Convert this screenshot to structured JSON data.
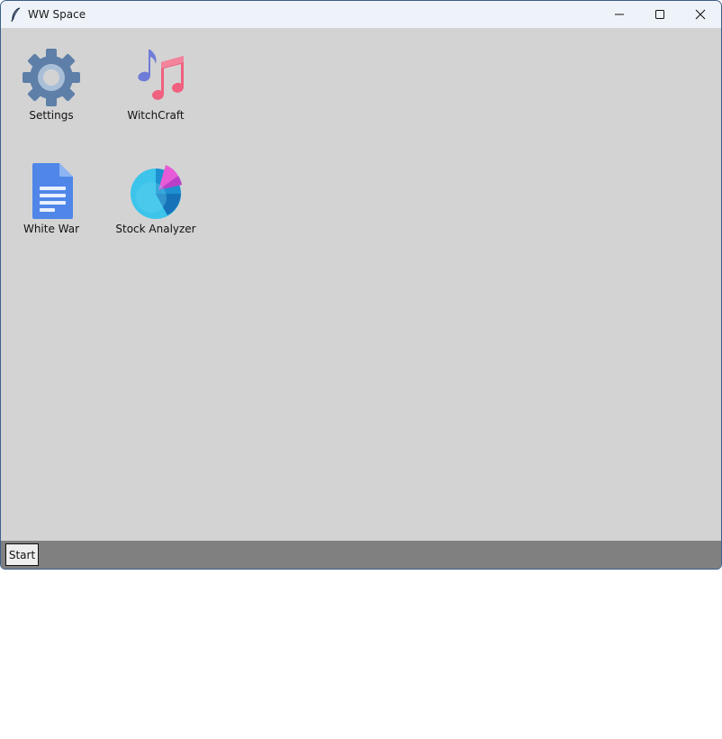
{
  "window": {
    "title": "WW Space",
    "title_icon": "feather-icon",
    "controls": {
      "minimize_icon": "minimize-icon",
      "maximize_icon": "maximize-icon",
      "close_icon": "close-icon"
    }
  },
  "desktop": {
    "background_color": "#d3d3d3",
    "icons": [
      {
        "label": "Settings",
        "icon": "gear-icon"
      },
      {
        "label": "WitchCraft",
        "icon": "music-notes-icon"
      },
      {
        "label": "White War",
        "icon": "document-icon"
      },
      {
        "label": "Stock Analyzer",
        "icon": "pie-chart-icon"
      }
    ]
  },
  "taskbar": {
    "background_color": "#808080",
    "start_label": "Start"
  }
}
